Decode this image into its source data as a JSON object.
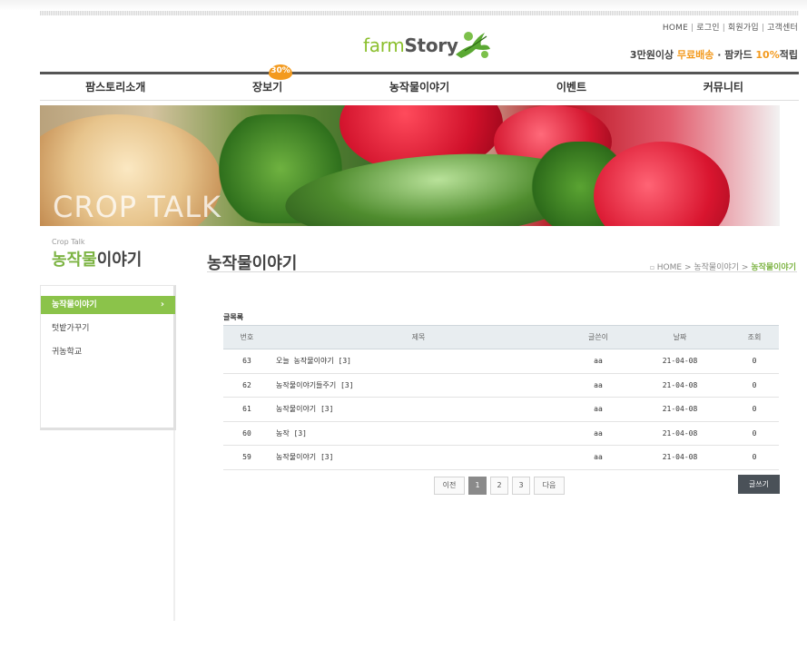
{
  "header": {
    "util_links": [
      "HOME",
      "로그인",
      "회원가입",
      "고객센터"
    ],
    "promo": {
      "prefix": "3만원이상 ",
      "free_shipping": "무료배송",
      "middle": " · 팜카드 ",
      "percent": "10%",
      "suffix": "적립"
    },
    "logo": {
      "farm": "farm",
      "story": "Story"
    }
  },
  "nav": {
    "items": [
      "팜스토리소개",
      "장보기",
      "농작물이야기",
      "이벤트",
      "커뮤니티"
    ],
    "badge": "30%"
  },
  "banner": {
    "text": "CROP TALK"
  },
  "sidebar": {
    "small_title": "Crop Talk",
    "title_green": "농작물",
    "title_rest": "이야기",
    "items": [
      {
        "label": "농작물이야기",
        "arrow": "›"
      },
      {
        "label": "텃밭가꾸기"
      },
      {
        "label": "귀농학교"
      }
    ]
  },
  "content": {
    "title": "농작물이야기",
    "breadcrumb": {
      "home": "HOME",
      "sep": " > ",
      "parent": "농작물이야기",
      "current": "농작물이야기"
    },
    "list_label": "글목록",
    "columns": [
      "번호",
      "제목",
      "글쓴이",
      "날짜",
      "조회"
    ],
    "rows": [
      {
        "no": "63",
        "title": "오늘 농작물이야기 [3]",
        "author": "aa",
        "date": "21-04-08",
        "hits": "0"
      },
      {
        "no": "62",
        "title": "농작물이야기들주기 [3]",
        "author": "aa",
        "date": "21-04-08",
        "hits": "0"
      },
      {
        "no": "61",
        "title": "농작물이야기 [3]",
        "author": "aa",
        "date": "21-04-08",
        "hits": "0"
      },
      {
        "no": "60",
        "title": "농작 [3]",
        "author": "aa",
        "date": "21-04-08",
        "hits": "0"
      },
      {
        "no": "59",
        "title": "농작물이야기 [3]",
        "author": "aa",
        "date": "21-04-08",
        "hits": "0"
      }
    ],
    "paging": {
      "prev": "이전",
      "pages": [
        "1",
        "2",
        "3"
      ],
      "next": "다음",
      "current": "1"
    },
    "write_button": "글쓰기"
  },
  "colors": {
    "accent_green": "#8bc34a",
    "accent_orange": "#f39a1e",
    "dark_button": "#4a5158"
  }
}
